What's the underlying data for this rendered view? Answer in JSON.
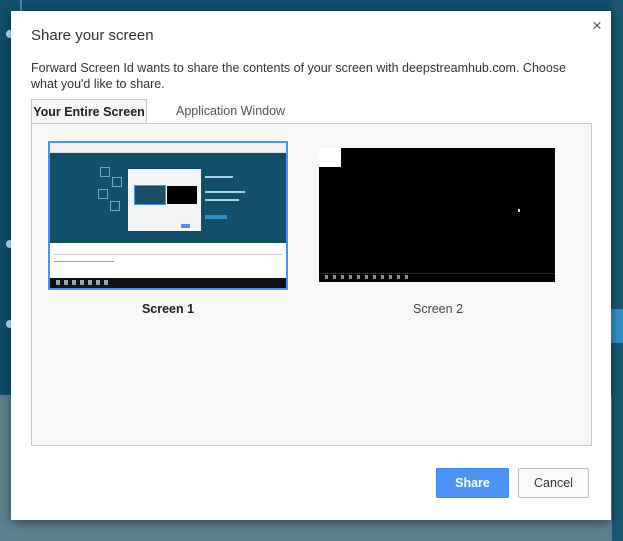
{
  "dialog": {
    "title": "Share your screen",
    "description": "Forward Screen Id wants to share the contents of your screen with deepstreamhub.com. Choose what you'd like to share.",
    "close_label": "×"
  },
  "tabs": [
    {
      "label": "Your Entire Screen",
      "active": true
    },
    {
      "label": "Application Window",
      "active": false
    }
  ],
  "screens": [
    {
      "label": "Screen 1",
      "selected": true
    },
    {
      "label": "Screen 2",
      "selected": false
    }
  ],
  "buttons": {
    "share": "Share",
    "cancel": "Cancel"
  },
  "colors": {
    "primary": "#4f93f7",
    "selection_border": "#4f8ff6",
    "background_page": "#114e69"
  },
  "icons": {
    "close": "close-icon"
  }
}
